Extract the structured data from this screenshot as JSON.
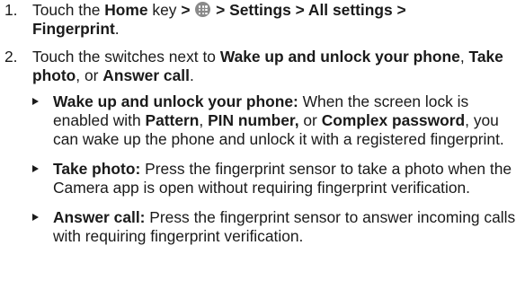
{
  "steps": [
    {
      "number": "1.",
      "t1": "Touch the ",
      "home": "Home",
      "t2": " key ",
      "gt1": ">",
      "gt2": "> Settings > All settings >",
      "fingerprint": "Fingerprint",
      "period": ".",
      "icon": "apps-icon"
    },
    {
      "number": "2.",
      "t1": "Touch the switches next to ",
      "wake": "Wake up and unlock your phone",
      "sep1": ", ",
      "take": "Take photo",
      "sep2": ", or ",
      "answer": "Answer call",
      "period": "."
    }
  ],
  "bullets": {
    "wake": {
      "title": "Wake up and unlock your phone:",
      "t1": " When the screen lock is enabled with ",
      "pattern": "Pattern",
      "sep1": ", ",
      "pin": "PIN number,",
      "sep2": " or ",
      "complex": "Complex password",
      "t2": ", you can wake up the phone and unlock it with a registered fingerprint."
    },
    "take": {
      "title": "Take photo:",
      "t1": " Press the fingerprint sensor to take a photo when the Camera app is open without requiring fingerprint verification."
    },
    "answer": {
      "title": "Answer call:",
      "t1": " Press the fingerprint sensor to answer incoming calls with requiring fingerprint verification."
    }
  }
}
